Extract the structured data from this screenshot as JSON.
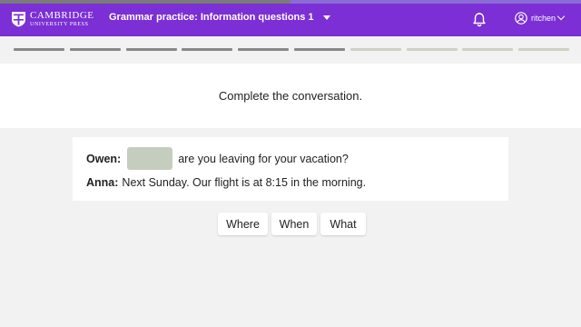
{
  "header": {
    "logo_line1": "CAMBRIDGE",
    "logo_line2": "UNIVERSITY PRESS",
    "activity_title": "Grammar practice: Information questions 1",
    "username": "ritchen",
    "bell_icon": "bell-icon",
    "user_icon": "user-circle-icon",
    "brand_color": "#7b2fd4"
  },
  "progress": {
    "total_questions": 10,
    "completed": 6
  },
  "instruction": "Complete the conversation.",
  "conversation": {
    "line1": {
      "speaker": "Owen:",
      "text": "are you leaving for your vacation?"
    },
    "line2": {
      "speaker": "Anna:",
      "text": "Next Sunday. Our flight is at 8:15 in the morning."
    }
  },
  "choices": [
    "Where",
    "When",
    "What"
  ]
}
